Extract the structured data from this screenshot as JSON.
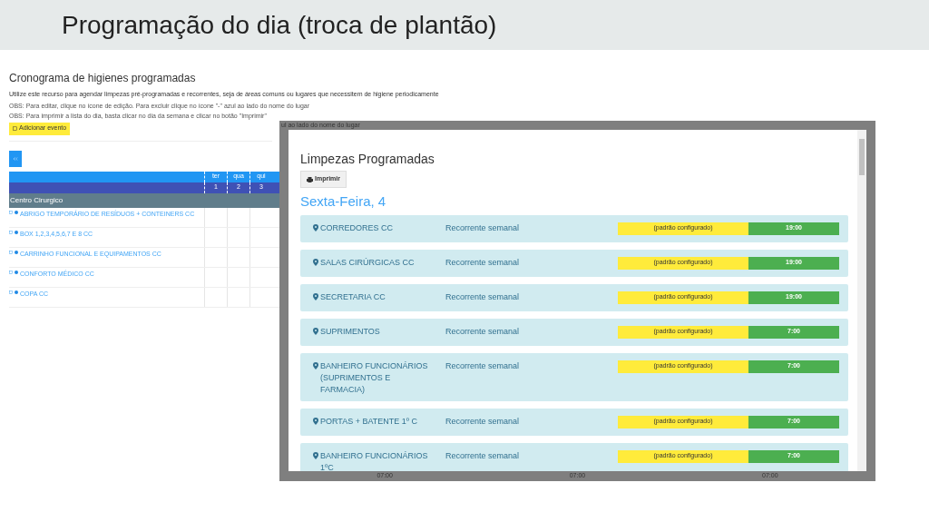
{
  "slide": {
    "title": "Programação do dia (troca de plantão)"
  },
  "app": {
    "heading": "Cronograma de higienes programadas",
    "description": "Utilize este recurso para agendar limpezas pré-programadas e recorrentes, seja de áreas comuns ou lugares que necessitem de higiene periodicamente",
    "notes": [
      "OBS: Para editar, clique no ícone de edição. Para excluir clique no ícone \"-\" azul ao lado do nome do lugar",
      "OBS: Para imprimir a lista do dia, basta clicar no dia da semana e clicar no botão \"Imprimir\""
    ],
    "add_button": "Adicionar evento",
    "table": {
      "columns": [
        "ter",
        "qua",
        "qui"
      ],
      "day_numbers": [
        "1",
        "2",
        "3"
      ],
      "group": "Centro Cirurgico",
      "rows": [
        "ABRIGO TEMPORÁRIO DE RESÍDUOS + CONTEINERS CC",
        "BOX 1,2,3,4,5,6,7 E 8 CC",
        "CARRINHO FUNCIONAL E EQUIPAMENTOS CC",
        "CONFORTO MÉDICO CC",
        "COPA CC"
      ]
    }
  },
  "backdrop": {
    "fragment": "ul ao lado do nome do lugar",
    "times": [
      "07:00",
      "07:00",
      "07:00"
    ]
  },
  "modal": {
    "title": "Limpezas Programadas",
    "print_button": "Imprimir",
    "day": "Sexta-Feira, 4",
    "items": [
      {
        "place": "CORREDORES CC",
        "recurrence": "Recorrente semanal",
        "status": "(padrão configurado)",
        "time": "19:00"
      },
      {
        "place": "SALAS CIRÚRGICAS CC",
        "recurrence": "Recorrente semanal",
        "status": "(padrão configurado)",
        "time": "19:00"
      },
      {
        "place": "SECRETARIA CC",
        "recurrence": "Recorrente semanal",
        "status": "(padrão configurado)",
        "time": "19:00"
      },
      {
        "place": "SUPRIMENTOS",
        "recurrence": "Recorrente semanal",
        "status": "(padrão configurado)",
        "time": "7:00"
      },
      {
        "place": "BANHEIRO FUNCIONÁRIOS (SUPRIMENTOS E FARMACIA)",
        "recurrence": "Recorrente semanal",
        "status": "(padrão configurado)",
        "time": "7:00"
      },
      {
        "place": "PORTAS + BATENTE 1º C",
        "recurrence": "Recorrente semanal",
        "status": "(padrão configurado)",
        "time": "7:00"
      },
      {
        "place": "BANHEIRO FUNCIONÁRIOS 1ºC",
        "recurrence": "Recorrente semanal",
        "status": "(padrão configurado)",
        "time": "7:00"
      }
    ]
  }
}
